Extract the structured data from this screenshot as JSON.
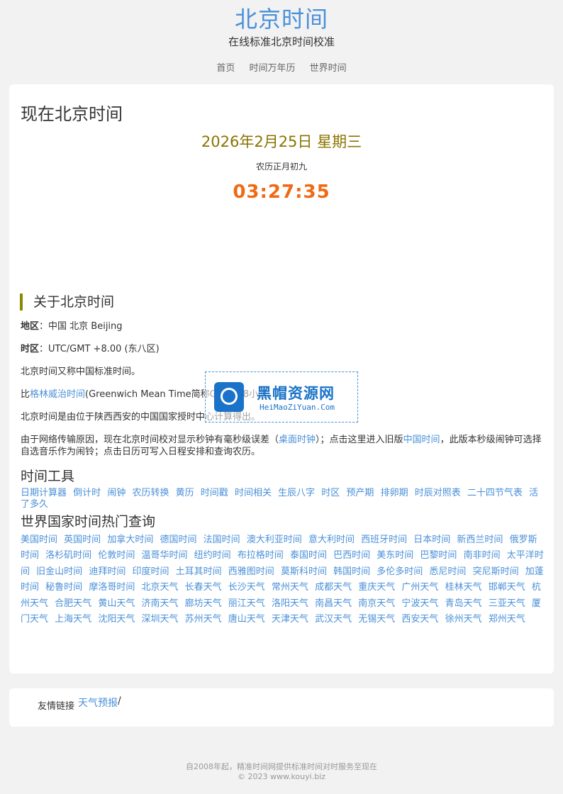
{
  "header": {
    "title": "北京时间",
    "subtitle": "在线标准北京时间校准",
    "nav": [
      "首页",
      "时间万年历",
      "世界时间"
    ]
  },
  "main": {
    "page_title": "现在北京时间",
    "date": "2026年2月25日 星期三",
    "lunar": "农历正月初九",
    "time": "03:27:35",
    "about_heading": "关于北京时间",
    "region_label": "地区",
    "region_value": "中国 北京 Beijing",
    "zone_label": "时区",
    "zone_value": "UTC/GMT +8.00 (东八区)",
    "para1": "北京时间又称中国标准时间。",
    "para2_prefix": "比",
    "para2_link": "格林威治时间",
    "para2_suffix": "(Greenwich Mean Time简称GMT)早8小时。",
    "para3": "北京时间是由位于陕西西安的中国国家授时中心计算得出。",
    "para4_a": "由于网络传输原因，现在北京时间校对显示秒钟有毫秒级误差（",
    "para4_link1": "桌面时钟",
    "para4_b": "）；点击这里进入旧版",
    "para4_link2": "中国时间",
    "para4_c": "，此版本秒级闹钟可选择自选音乐作为闹铃；点击日历可写入日程安排和查询农历。",
    "tools_heading": "时间工具",
    "tools": [
      "日期计算器",
      "倒计时",
      "闹钟",
      "农历转换",
      "黄历",
      "时间戳",
      "时间相关",
      "生辰八字",
      "时区",
      "预产期",
      "排卵期",
      "时辰对照表",
      "二十四节气表",
      "活了多久"
    ],
    "world_heading": "世界国家时间热门查询",
    "world_links": [
      "美国时间",
      "英国时间",
      "加拿大时间",
      "德国时间",
      "法国时间",
      "澳大利亚时间",
      "意大利时间",
      "西班牙时间",
      "日本时间",
      "新西兰时间",
      "俄罗斯时间",
      "洛杉矶时间",
      "伦敦时间",
      "温哥华时间",
      "纽约时间",
      "布拉格时间",
      "泰国时间",
      "巴西时间",
      "美东时间",
      "巴黎时间",
      "南非时间",
      "太平洋时间",
      "旧金山时间",
      "迪拜时间",
      "印度时间",
      "土耳其时间",
      "西雅图时间",
      "莫斯科时间",
      "韩国时间",
      "多伦多时间",
      "悉尼时间",
      "突尼斯时间",
      "加蓬时间",
      "秘鲁时间",
      "摩洛哥时间",
      "北京天气",
      "长春天气",
      "长沙天气",
      "常州天气",
      "成都天气",
      "重庆天气",
      "广州天气",
      "桂林天气",
      "邯郸天气",
      "杭州天气",
      "合肥天气",
      "黄山天气",
      "济南天气",
      "廊坊天气",
      "丽江天气",
      "洛阳天气",
      "南昌天气",
      "南京天气",
      "宁波天气",
      "青岛天气",
      "三亚天气",
      "厦门天气",
      "上海天气",
      "沈阳天气",
      "深圳天气",
      "苏州天气",
      "唐山天气",
      "天津天气",
      "武汉天气",
      "无锡天气",
      "西安天气",
      "徐州天气",
      "郑州天气"
    ]
  },
  "watermark": {
    "cn": "黑帽资源网",
    "en": "HeiMaoZiYuan.Com"
  },
  "footer": {
    "friend_label": "友情链接",
    "friend_link": "天气预报",
    "friend_sep": "/",
    "line1": "自2008年起，精准时间网提供标准时间对时服务至现在",
    "line2": "© 2023 www.kouyi.biz"
  },
  "colors": {
    "accent": "#4a90d9",
    "date": "#8a7400",
    "time": "#f06a14"
  }
}
